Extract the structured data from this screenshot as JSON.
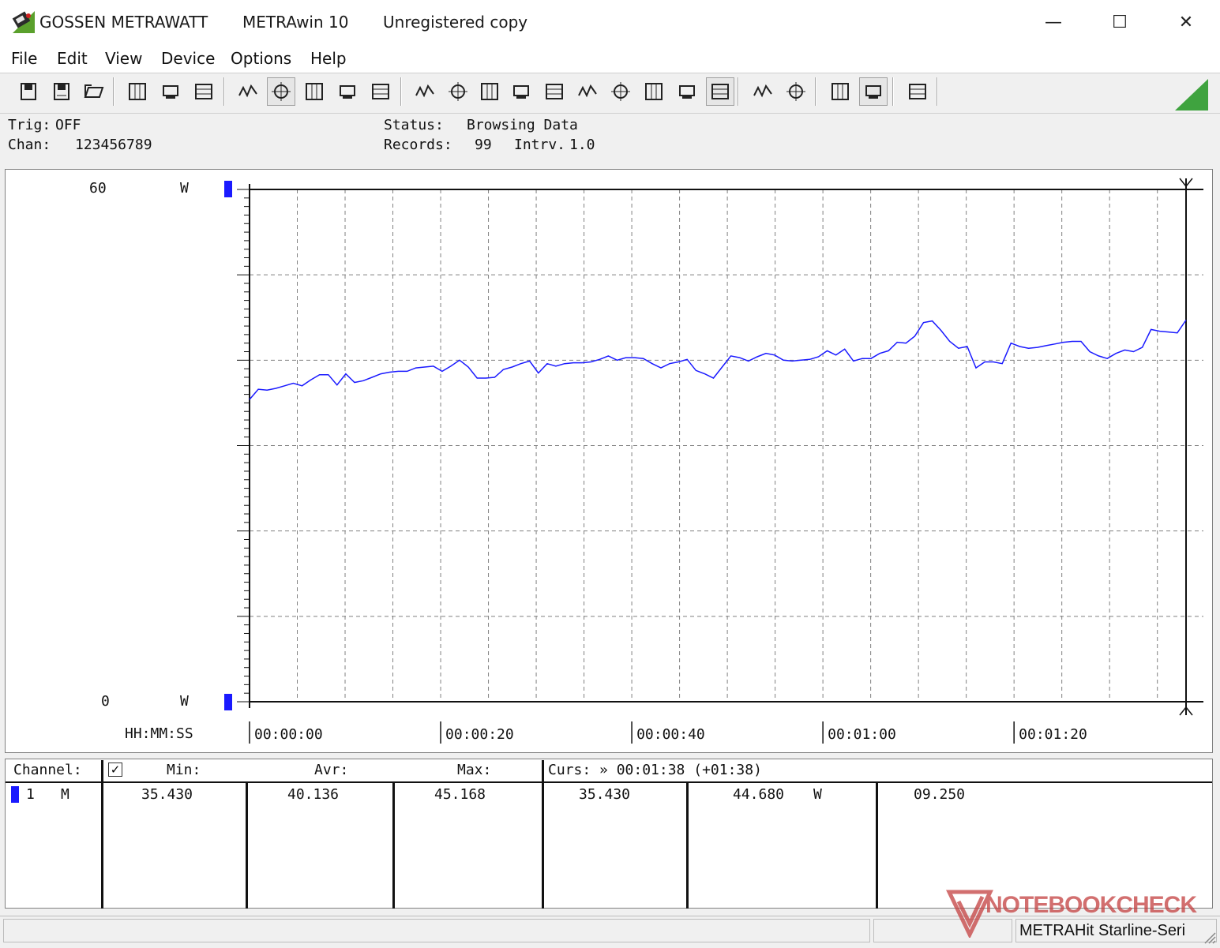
{
  "window": {
    "company": "GOSSEN METRAWATT",
    "app": "METRAwin 10",
    "registration": "Unregistered copy",
    "minimize_glyph": "—",
    "maximize_glyph": "☐",
    "close_glyph": "✕"
  },
  "menu": [
    {
      "label": "File"
    },
    {
      "label": "Edit"
    },
    {
      "label": "View"
    },
    {
      "label": "Device"
    },
    {
      "label": "Options"
    },
    {
      "label": "Help"
    }
  ],
  "toolbar_icons": [
    "save-icon",
    "save-as-icon",
    "open-folder-icon",
    "device-read-icon",
    "device-config-icon",
    "device-write-icon",
    "table-view-icon",
    "wave-view-icon",
    "crosshair-icon",
    "grid-icon",
    "bars-icon",
    "export-icon",
    "copy-icon",
    "list-icon",
    "monitor-icon",
    "function-icon",
    "printer-device-icon",
    "signal-icon",
    "signal-dense-icon",
    "search-device-icon",
    "trigger-icon",
    "print-icon",
    "print-preview-icon",
    "zoom-icon",
    "zoom-wave-icon",
    "comment-icon"
  ],
  "info": {
    "trig_label": "Trig:",
    "trig_value": "OFF",
    "chan_label": "Chan:",
    "chan_value": "123456789",
    "status_label": "Status:",
    "status_value": "Browsing Data",
    "records_label": "Records:",
    "records_value": "99",
    "intrv_label": "Intrv.",
    "intrv_value": "1.0"
  },
  "chart_data": {
    "type": "line",
    "title": "",
    "xlabel": "HH:MM:SS",
    "ylabel": "W",
    "y_top_label": "60",
    "y_bottom_label": "0",
    "y_unit": "W",
    "ylim": [
      0,
      60
    ],
    "xlim": [
      0,
      98
    ],
    "x_ticks": [
      "00:00:00",
      "00:00:20",
      "00:00:40",
      "00:01:00",
      "00:01:20"
    ],
    "x_tick_values": [
      0,
      20,
      40,
      60,
      80
    ],
    "grid": true,
    "line_color": "#1a1aff",
    "series": [
      {
        "values": [
          35.4,
          36.6,
          36.5,
          36.7,
          37.0,
          37.3,
          37.0,
          37.7,
          38.3,
          38.3,
          37.1,
          38.4,
          37.4,
          37.6,
          38.0,
          38.4,
          38.6,
          38.7,
          38.7,
          39.1,
          39.2,
          39.3,
          38.7,
          39.3,
          40.0,
          39.2,
          37.9,
          37.9,
          38.0,
          38.9,
          39.2,
          39.6,
          39.9,
          38.5,
          39.6,
          39.3,
          39.6,
          39.7,
          39.7,
          39.8,
          40.1,
          40.5,
          40.0,
          40.3,
          40.3,
          40.2,
          39.6,
          39.1,
          39.6,
          39.8,
          40.1,
          38.8,
          38.4,
          37.9,
          39.2,
          40.5,
          40.3,
          39.9,
          40.4,
          40.8,
          40.6,
          40.0,
          39.9,
          40.0,
          40.1,
          40.4,
          41.1,
          40.6,
          41.3,
          39.9,
          40.2,
          40.2,
          40.8,
          41.1,
          42.1,
          42.0,
          42.8,
          44.4,
          44.6,
          43.5,
          42.2,
          41.4,
          41.6,
          39.1,
          39.8,
          39.8,
          39.6,
          42.0,
          41.6,
          41.4,
          41.5,
          41.7,
          41.9,
          42.1,
          42.2,
          42.2,
          41.0,
          40.5,
          40.2,
          40.8,
          41.2,
          41.0,
          41.5,
          43.6,
          43.4,
          43.3,
          43.2,
          44.7
        ]
      }
    ]
  },
  "table": {
    "header": {
      "channel": "Channel:",
      "check": "✓",
      "min": "Min:",
      "avr": "Avr:",
      "max": "Max:",
      "curs": "Curs: » 00:01:38 (+01:38)"
    },
    "row": {
      "channel_num": "1",
      "mode": "M",
      "min": "35.430",
      "avr": "40.136",
      "max": "45.168",
      "curs_value": "35.430",
      "curs_value2": "44.680",
      "unit": "W",
      "extra": "09.250"
    }
  },
  "statusbar": {
    "device": "METRAHit Starline-Seri"
  },
  "watermark": {
    "text": "NOTEBOOKCHECK"
  },
  "colors": {
    "accent_blue": "#1a1aff",
    "grid": "#808080",
    "window_bg": "#f0f0f0",
    "watermark_red": "#c44040"
  }
}
